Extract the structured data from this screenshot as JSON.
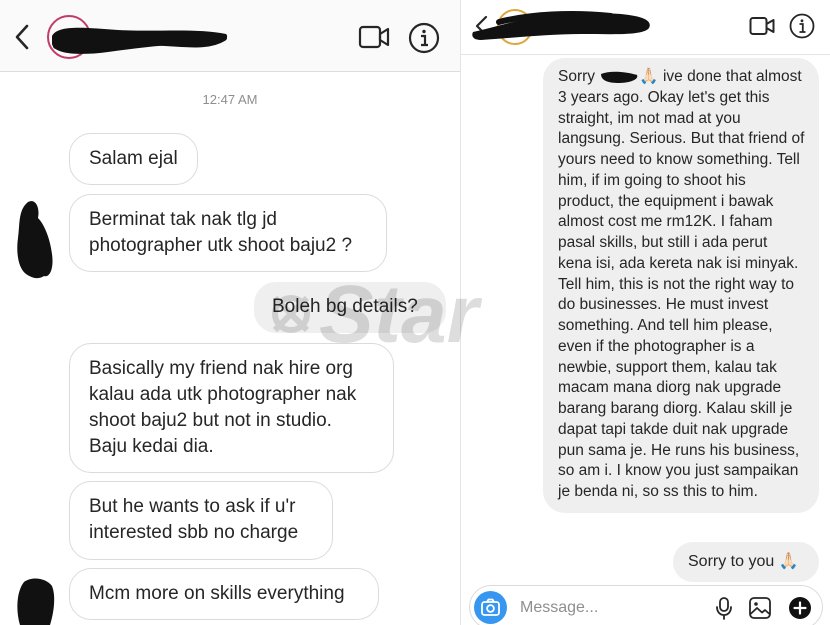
{
  "left_chat": {
    "timestamp": "12:47 AM",
    "messages": [
      {
        "text": "Salam ejal"
      },
      {
        "text": "Berminat tak nak tlg jd photographer utk shoot baju2 ?"
      },
      {
        "text": "Boleh bg details?"
      },
      {
        "text": "Basically my friend nak hire org kalau ada utk photographer nak shoot baju2 but not in studio. Baju kedai dia."
      },
      {
        "text": "But he wants to ask if u'r interested sbb no charge"
      },
      {
        "text": "Mcm more on skills everything"
      }
    ]
  },
  "right_chat": {
    "long_message": {
      "prefix": "Sorry",
      "emoji": "🙏🏻",
      "body": "ive done that almost 3 years ago. Okay let's get this straight, im not mad at you langsung. Serious. But that friend of yours need to know something. Tell him, if im going to shoot his product, the equipment i bawak almost cost me rm12K. I faham pasal skills, but still i ada perut kena isi, ada kereta nak isi minyak. Tell him, this is not the right way to do businesses. He must invest something. And tell him please, even if the photographer is a newbie, support them, kalau tak macam mana diorg nak upgrade barang barang diorg. Kalau skill je dapat tapi takde duit nak upgrade pun sama je. He runs his business, so am i. I know you just sampaikan je benda ni, so ss this to him."
    },
    "reply": "Sorry to you 🙏🏻",
    "composer": {
      "placeholder": "Message..."
    }
  },
  "watermark": {
    "text": "Star"
  },
  "icons": {
    "back": "chevron-left-icon",
    "video": "video-camera-icon",
    "info": "info-icon",
    "camera": "camera-icon",
    "mic": "microphone-icon",
    "gallery": "image-icon",
    "plus": "plus-circle-icon"
  },
  "colors": {
    "incoming_border": "#dbdbdb",
    "outgoing_bg": "#efefef",
    "accent_blue": "#3797f0",
    "redaction": "#111111"
  }
}
